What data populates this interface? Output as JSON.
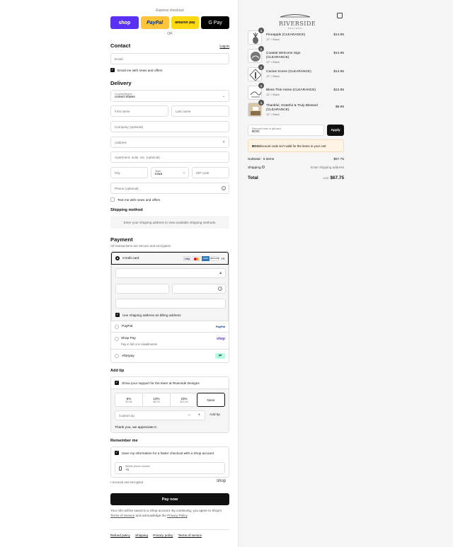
{
  "express": {
    "title": "Express checkout",
    "buttons": [
      {
        "label": "shop",
        "bg": "#5a31f4",
        "fg": "#ffffff"
      },
      {
        "label": "PayPal",
        "bg": "#ffc439",
        "fg": "#003087"
      },
      {
        "label": "amazon pay",
        "bg": "#ffd814",
        "fg": "#111111"
      },
      {
        "label": "G Pay",
        "bg": "#000000",
        "fg": "#ffffff"
      }
    ],
    "or": "OR"
  },
  "contact": {
    "heading": "Contact",
    "login": "Log in",
    "email_placeholder": "Email",
    "news_label": "Email me with news and offers"
  },
  "delivery": {
    "heading": "Delivery",
    "country_label": "Country/Region",
    "country_value": "United States",
    "first_name": "First name",
    "last_name": "Last name",
    "company": "Company (optional)",
    "address": "Address",
    "apartment": "Apartment, suite, etc. (optional)",
    "city": "City",
    "state_label": "State",
    "state_value": "Iowa",
    "zip": "ZIP code",
    "phone": "Phone (optional)",
    "text_label": "Text me with news and offers"
  },
  "shipping": {
    "heading": "Shipping method",
    "message": "Enter your shipping address to view available shipping methods."
  },
  "payment": {
    "heading": "Payment",
    "subtitle": "All transactions are secure and encrypted.",
    "credit_card": "Credit card",
    "card_more": "+4",
    "billing_label": "Use shipping address as billing address",
    "paypal": "PayPal",
    "paypal_badge": "PayPal",
    "shoppay": "Shop Pay",
    "shoppay_sub": "Pay in full or in installments",
    "shoppay_badge": "shop",
    "afterpay": "Afterpay"
  },
  "tip": {
    "heading": "Add tip",
    "support_label": "Show your support for the team at Riverside Designs",
    "options": [
      {
        "pct": "5%",
        "amt": "$3.36"
      },
      {
        "pct": "10%",
        "amt": "$6.78"
      },
      {
        "pct": "15%",
        "amt": "$10.16"
      },
      {
        "pct": "None",
        "amt": ""
      }
    ],
    "custom_placeholder": "Custom tip",
    "add_label": "Add tip",
    "thanks": "Thank you, we appreciate it."
  },
  "remember": {
    "heading": "Remember me",
    "save_label": "Save my information for a faster checkout with a Shop account",
    "mobile_label": "Mobile phone number",
    "mobile_value": "+1",
    "secure": "Secured and encrypted",
    "shop": "shop"
  },
  "paynow": "Pay now",
  "consent": {
    "prefix": "Your info will be saved to a Shop account. By continuing, you agree to Shop's ",
    "tos": "Terms of Service",
    "middle": " and acknowledge the ",
    "privacy": "Privacy Policy",
    "suffix": "."
  },
  "footer": [
    "Refund policy",
    "Shipping",
    "Privacy policy",
    "Terms of service"
  ],
  "store": {
    "name": "RIVERSIDE",
    "tagline": "DESIGNS"
  },
  "cart": {
    "items": [
      {
        "qty": "1",
        "name": "Pineapple (CLEARANCE)",
        "variant": "12\" / Black",
        "price": "$14.95"
      },
      {
        "qty": "1",
        "name": "Coastal Welcome Sign (CLEARANCE)",
        "variant": "12\" / Black",
        "price": "$14.95"
      },
      {
        "qty": "1",
        "name": "Cactus Scene (CLEARANCE)",
        "variant": "12\" / Black",
        "price": "$14.95"
      },
      {
        "qty": "1",
        "name": "Bless This Home (CLEARANCE)",
        "variant": "12\" / Black",
        "price": "$12.95"
      },
      {
        "qty": "1",
        "name": "Thankful, Grateful & Truly Blessed (CLEARANCE)",
        "variant": "12\" / Black",
        "price": "$9.95"
      }
    ],
    "discount_label": "Discount code or gift card",
    "discount_value": "BOO",
    "apply": "Apply",
    "error_code": "BOO",
    "error_msg": " discount code isn't valid for the items in your cart",
    "subtotal_label": "Subtotal · 5 items",
    "subtotal_value": "$67.75",
    "shipping_label": "Shipping",
    "shipping_value": "Enter shipping address",
    "total_label": "Total",
    "currency": "USD",
    "total_value": "$67.75"
  }
}
